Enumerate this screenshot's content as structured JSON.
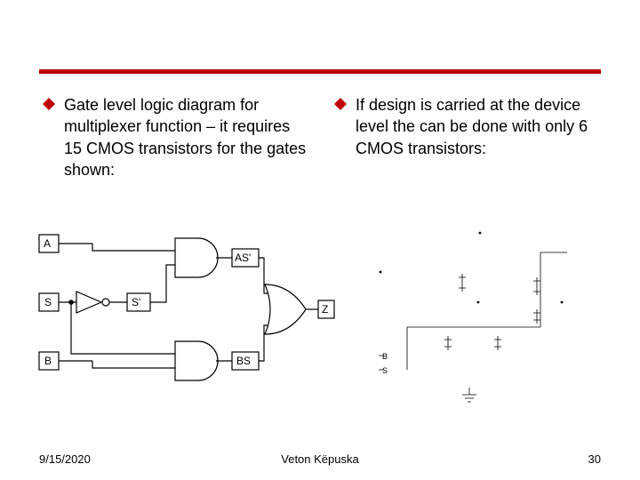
{
  "left": {
    "text": "Gate level logic diagram for multiplexer function – it requires 15 CMOS transistors for the gates shown:",
    "labels": {
      "A": "A",
      "S": "S",
      "B": "B",
      "Sn": "S'",
      "ASn": "AS'",
      "BS": "BS",
      "Z": "Z"
    }
  },
  "right": {
    "text": "If design is carried at the device level the can be done with only 6 CMOS transistors:",
    "labels": {
      "B": "B",
      "S": "S"
    }
  },
  "footer": {
    "date": "9/15/2020",
    "author": "Veton Këpuska",
    "page": "30"
  }
}
